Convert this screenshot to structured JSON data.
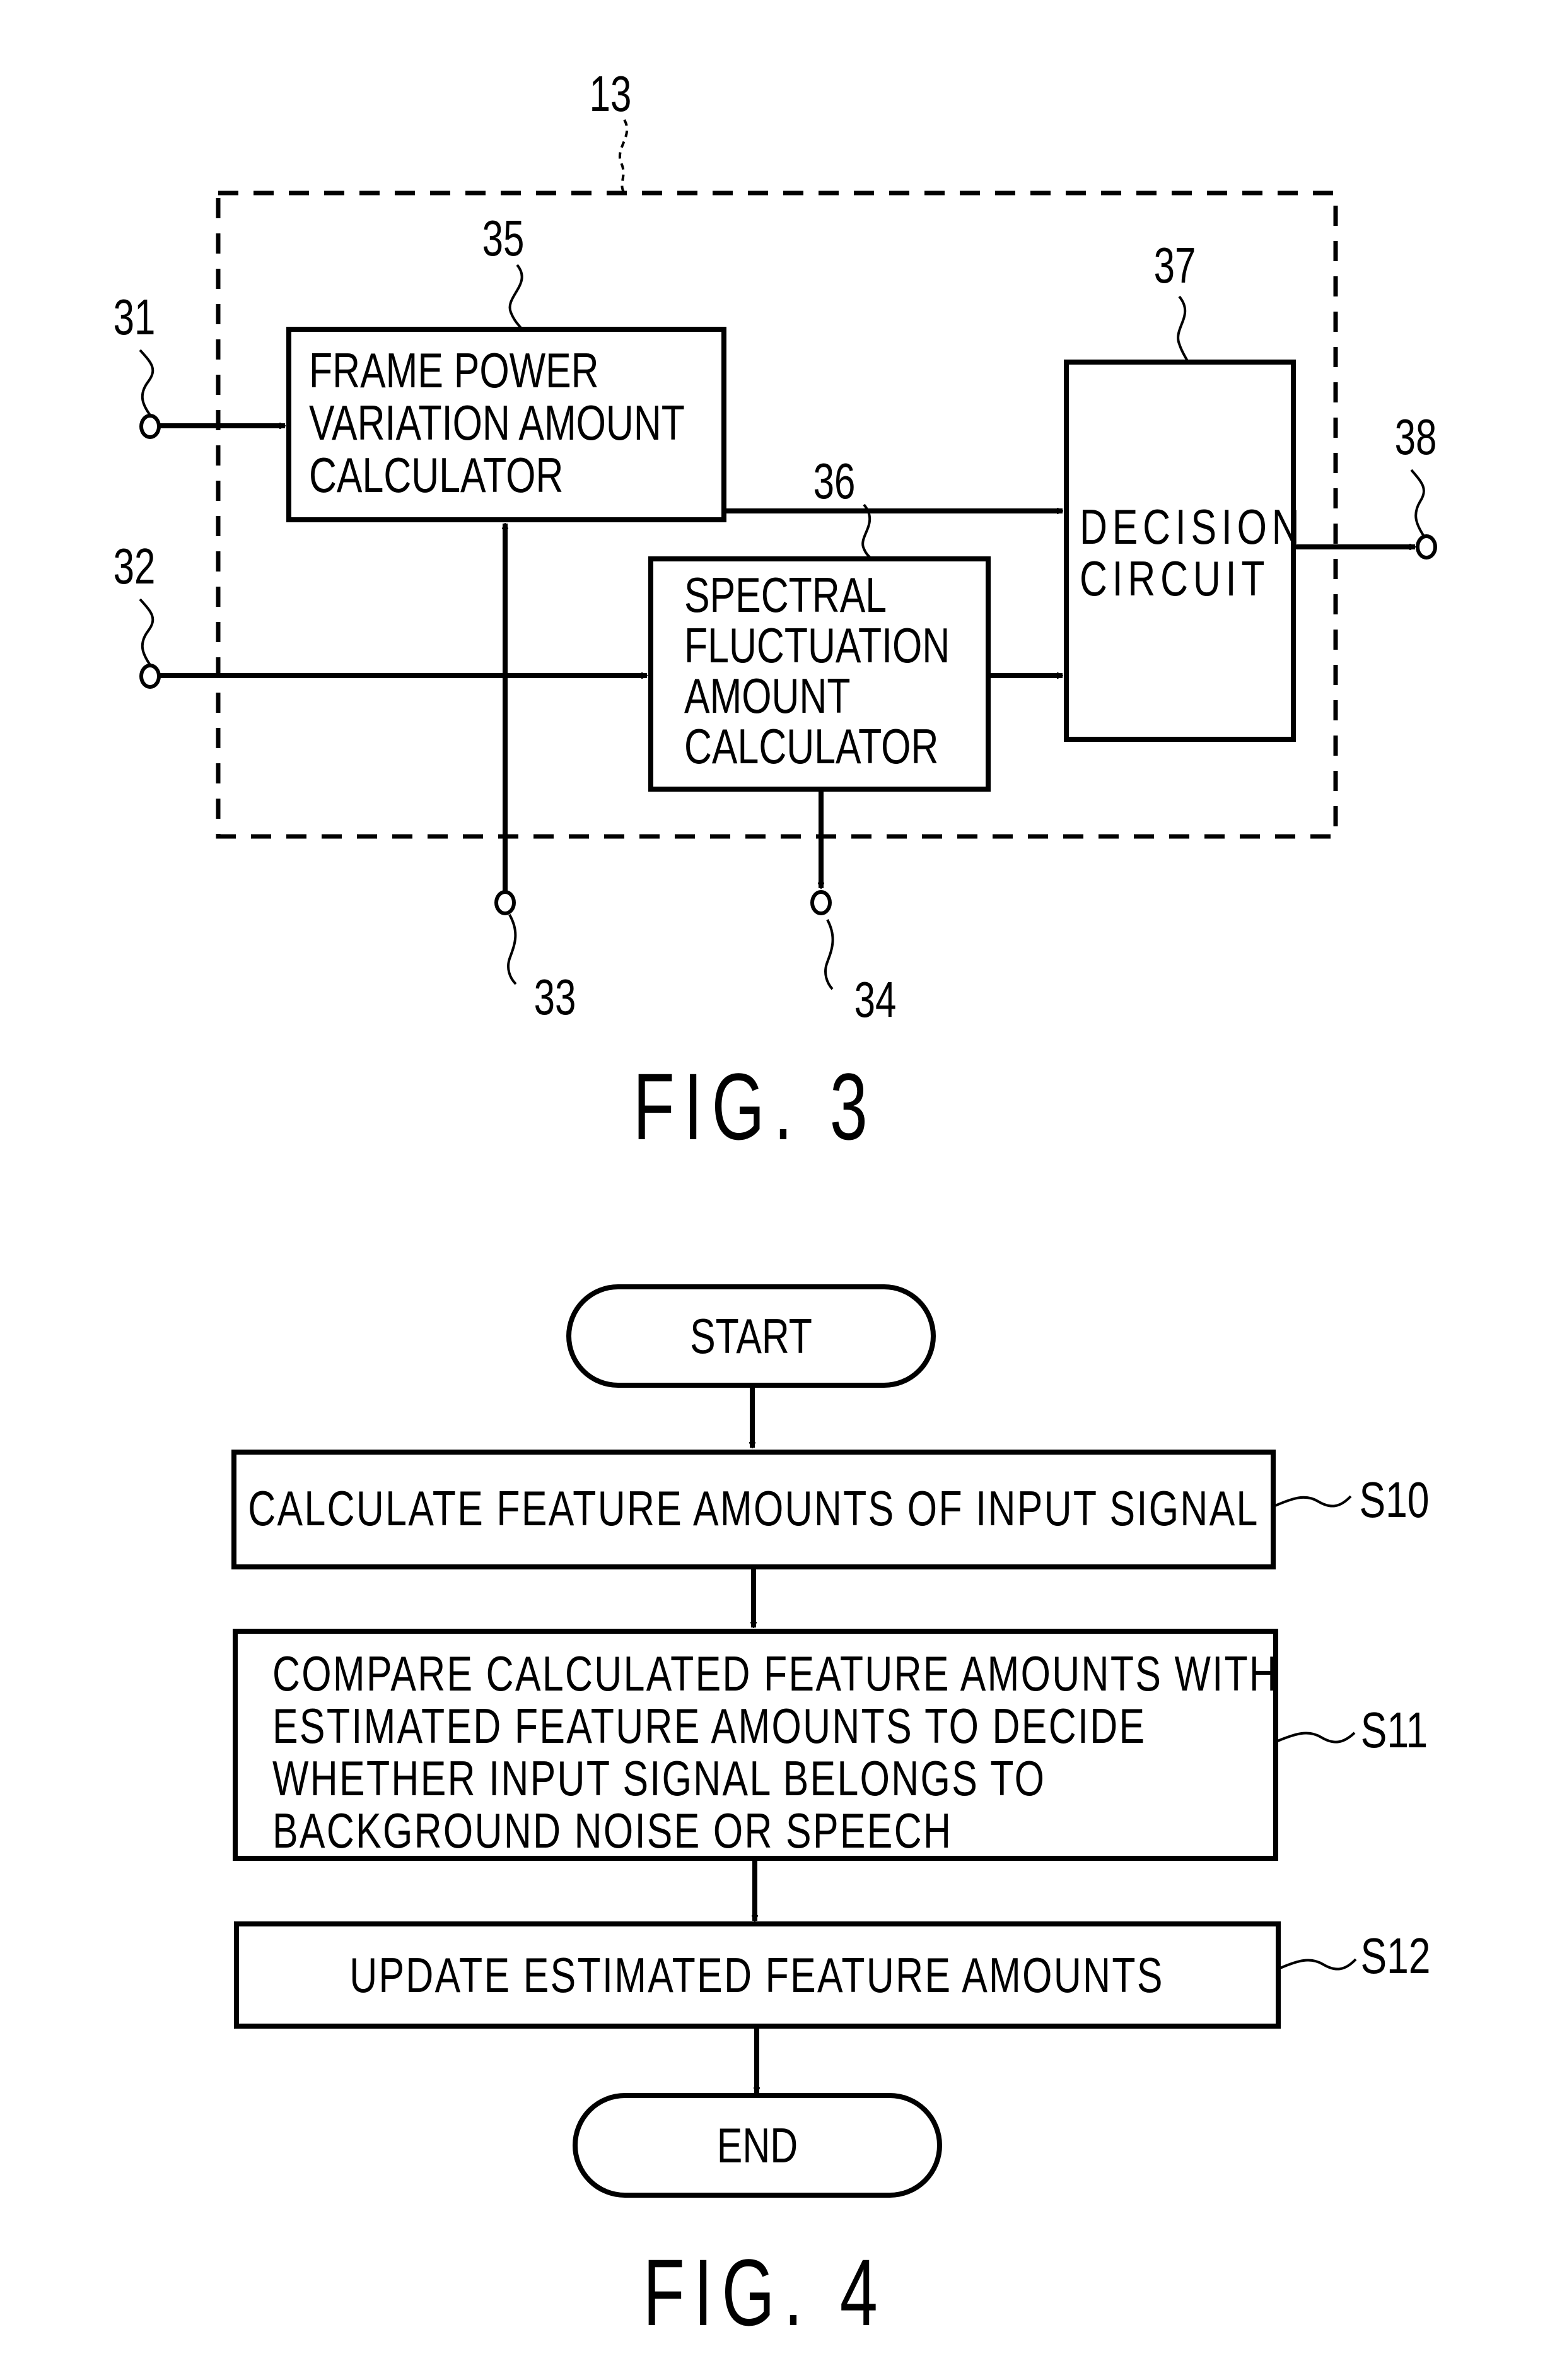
{
  "figures": [
    {
      "id": "fig3",
      "caption": "FIG. 3",
      "group_ref": "13",
      "blocks": {
        "b35": {
          "ref": "35",
          "lines": [
            "FRAME POWER",
            "VARIATION AMOUNT",
            "CALCULATOR"
          ]
        },
        "b36": {
          "ref": "36",
          "lines": [
            "SPECTRAL",
            "FLUCTUATION",
            "AMOUNT",
            "CALCULATOR"
          ]
        },
        "b37": {
          "ref": "37",
          "lines": [
            "DECISION",
            "CIRCUIT"
          ]
        }
      },
      "terminals": {
        "t31": "31",
        "t32": "32",
        "t33": "33",
        "t34": "34",
        "t38": "38"
      }
    },
    {
      "id": "fig4",
      "caption": "FIG. 4",
      "start": "START",
      "end": "END",
      "steps": [
        {
          "ref": "S10",
          "lines": [
            "CALCULATE FEATURE AMOUNTS OF INPUT SIGNAL"
          ]
        },
        {
          "ref": "S11",
          "lines": [
            "COMPARE CALCULATED FEATURE AMOUNTS WITH",
            "ESTIMATED FEATURE AMOUNTS TO DECIDE",
            "WHETHER INPUT SIGNAL BELONGS TO",
            "BACKGROUND NOISE OR SPEECH"
          ]
        },
        {
          "ref": "S12",
          "lines": [
            "UPDATE ESTIMATED FEATURE AMOUNTS"
          ]
        }
      ]
    }
  ]
}
